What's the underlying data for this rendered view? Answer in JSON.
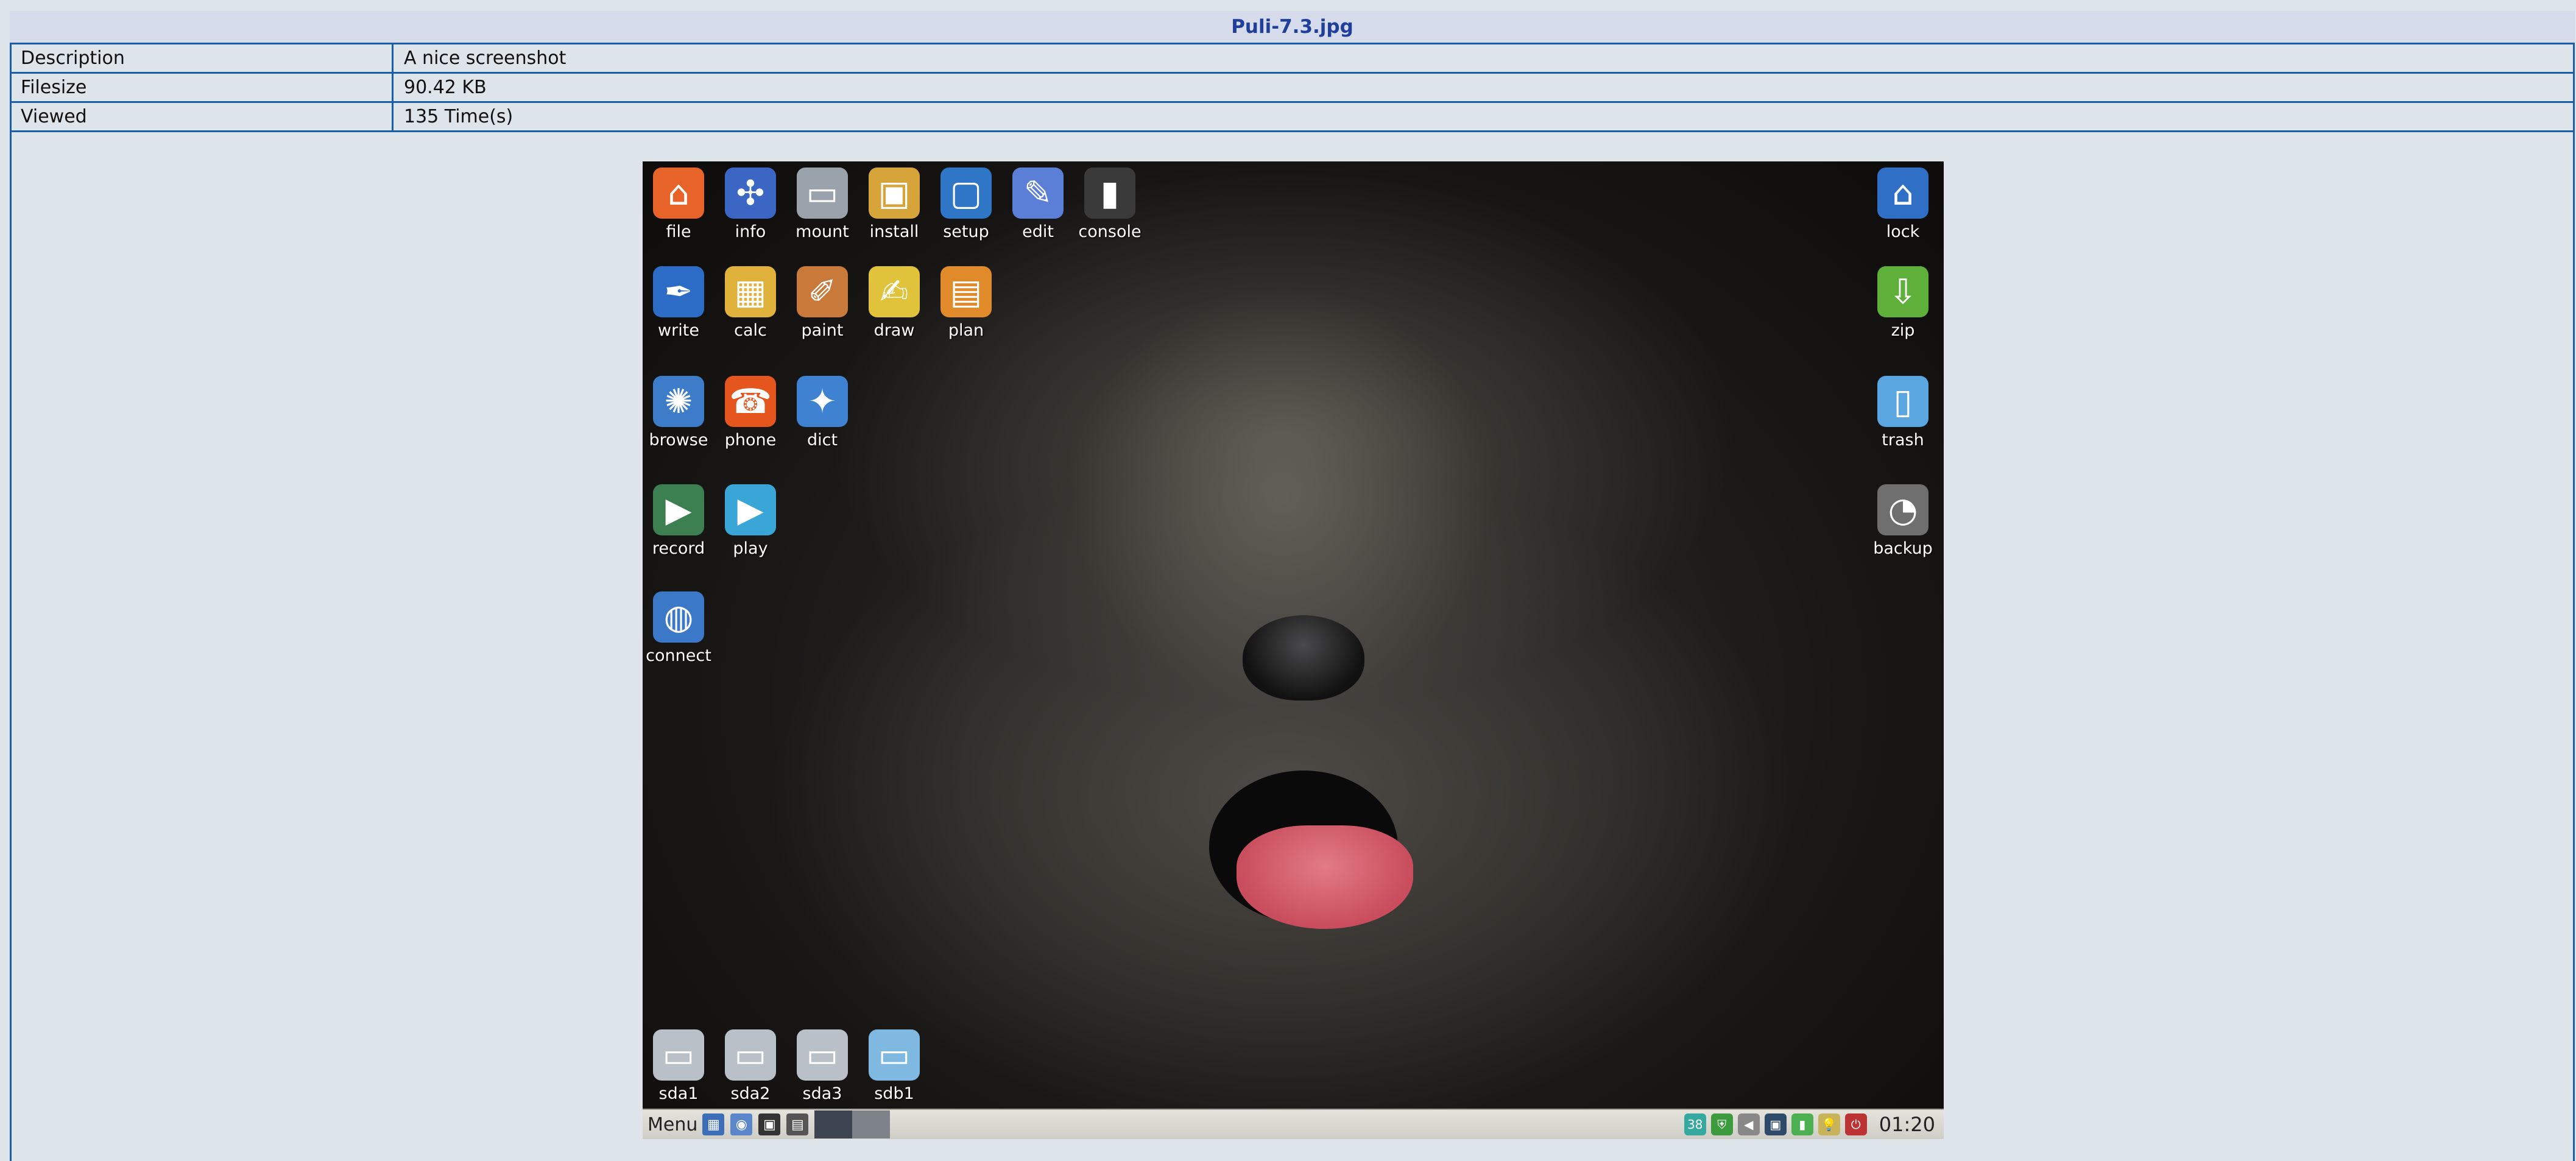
{
  "page": {
    "title": "Puli-7.3.jpg",
    "rows": [
      {
        "label": "Description",
        "value": "A nice screenshot"
      },
      {
        "label": "Filesize",
        "value": "90.42 KB"
      },
      {
        "label": "Viewed",
        "value": "135 Time(s)"
      }
    ]
  },
  "desktop": {
    "left_icons": [
      {
        "label": "file",
        "icon": "home-icon",
        "color": "#e7632a"
      },
      {
        "label": "info",
        "icon": "network-icon",
        "color": "#3b66c4"
      },
      {
        "label": "mount",
        "icon": "drive-icon",
        "color": "#9aa3ab"
      },
      {
        "label": "install",
        "icon": "package-icon",
        "color": "#d7a43a"
      },
      {
        "label": "setup",
        "icon": "monitor-icon",
        "color": "#2f77c6"
      },
      {
        "label": "edit",
        "icon": "brush-icon",
        "color": "#5b7fd6"
      },
      {
        "label": "console",
        "icon": "terminal-icon",
        "color": "#3a3a3a"
      },
      {
        "label": "write",
        "icon": "pen-icon",
        "color": "#2c6cc7"
      },
      {
        "label": "calc",
        "icon": "spreadsheet-icon",
        "color": "#e0b23b"
      },
      {
        "label": "paint",
        "icon": "paintbrush-icon",
        "color": "#c97a3a"
      },
      {
        "label": "draw",
        "icon": "draw-icon",
        "color": "#e0c23b"
      },
      {
        "label": "plan",
        "icon": "calendar-icon",
        "color": "#e08a2a"
      },
      {
        "label": "browse",
        "icon": "browser-icon",
        "color": "#3d7cc9"
      },
      {
        "label": "phone",
        "icon": "phone-icon",
        "color": "#e4561e"
      },
      {
        "label": "dict",
        "icon": "dictionary-icon",
        "color": "#3f82d1"
      },
      {
        "label": "record",
        "icon": "record-icon",
        "color": "#3c7f50"
      },
      {
        "label": "play",
        "icon": "play-icon",
        "color": "#3aa6d8"
      },
      {
        "label": "connect",
        "icon": "globe-icon",
        "color": "#3b78c8"
      }
    ],
    "right_icons": [
      {
        "label": "lock",
        "icon": "lock-icon",
        "color": "#2f6fc5"
      },
      {
        "label": "zip",
        "icon": "zip-icon",
        "color": "#5fb03a"
      },
      {
        "label": "trash",
        "icon": "trash-icon",
        "color": "#5aa6e0"
      },
      {
        "label": "backup",
        "icon": "backup-icon",
        "color": "#6f6f6f"
      }
    ],
    "drives": [
      {
        "label": "sda1"
      },
      {
        "label": "sda2"
      },
      {
        "label": "sda3"
      },
      {
        "label": "sdb1"
      }
    ],
    "taskbar": {
      "menu_label": "Menu",
      "tray_temp": "38",
      "clock": "01:20"
    }
  }
}
